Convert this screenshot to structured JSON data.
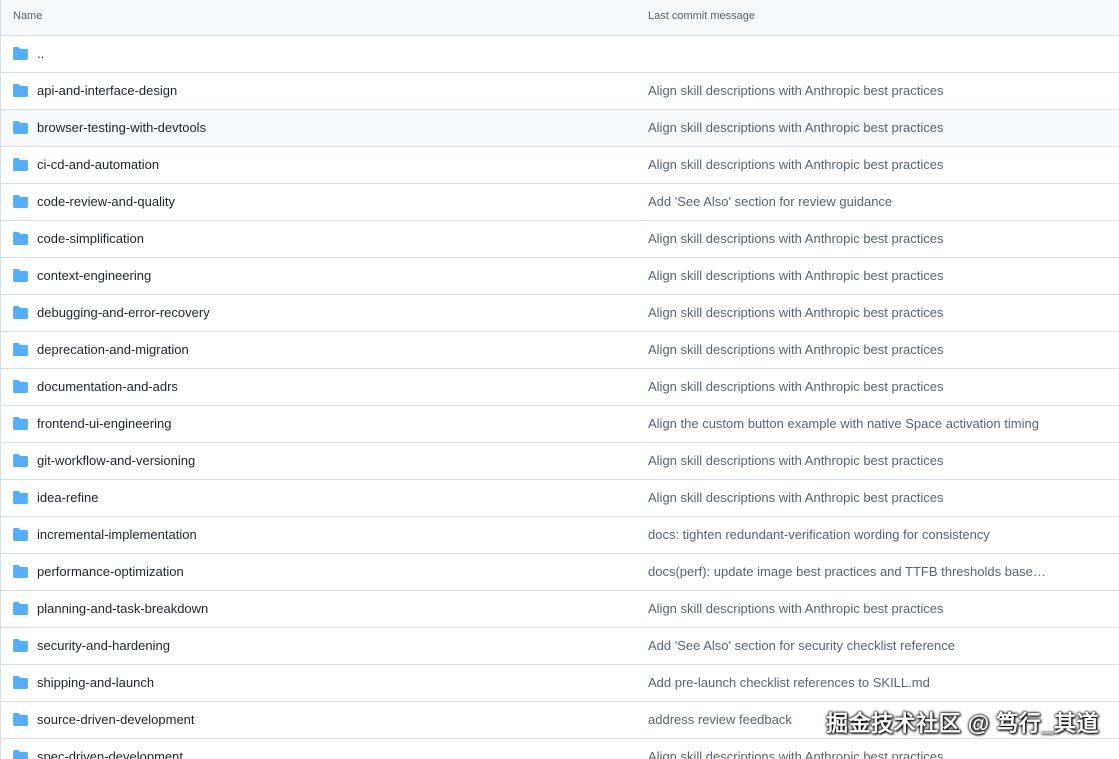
{
  "header": {
    "name_label": "Name",
    "message_label": "Last commit message"
  },
  "folder_color": "#54aeff",
  "rows": [
    {
      "name": "..",
      "message": ""
    },
    {
      "name": "api-and-interface-design",
      "message": "Align skill descriptions with Anthropic best practices"
    },
    {
      "name": "browser-testing-with-devtools",
      "message": "Align skill descriptions with Anthropic best practices"
    },
    {
      "name": "ci-cd-and-automation",
      "message": "Align skill descriptions with Anthropic best practices"
    },
    {
      "name": "code-review-and-quality",
      "message": "Add 'See Also' section for review guidance"
    },
    {
      "name": "code-simplification",
      "message": "Align skill descriptions with Anthropic best practices"
    },
    {
      "name": "context-engineering",
      "message": "Align skill descriptions with Anthropic best practices"
    },
    {
      "name": "debugging-and-error-recovery",
      "message": "Align skill descriptions with Anthropic best practices"
    },
    {
      "name": "deprecation-and-migration",
      "message": "Align skill descriptions with Anthropic best practices"
    },
    {
      "name": "documentation-and-adrs",
      "message": "Align skill descriptions with Anthropic best practices"
    },
    {
      "name": "frontend-ui-engineering",
      "message": "Align the custom button example with native Space activation timing"
    },
    {
      "name": "git-workflow-and-versioning",
      "message": "Align skill descriptions with Anthropic best practices"
    },
    {
      "name": "idea-refine",
      "message": "Align skill descriptions with Anthropic best practices"
    },
    {
      "name": "incremental-implementation",
      "message": "docs: tighten redundant-verification wording for consistency"
    },
    {
      "name": "performance-optimization",
      "message": "docs(perf): update image best practices and TTFB thresholds based on ..."
    },
    {
      "name": "planning-and-task-breakdown",
      "message": "Align skill descriptions with Anthropic best practices"
    },
    {
      "name": "security-and-hardening",
      "message": "Add 'See Also' section for security checklist reference"
    },
    {
      "name": "shipping-and-launch",
      "message": "Add pre-launch checklist references to SKILL.md"
    },
    {
      "name": "source-driven-development",
      "message": "address review feedback"
    },
    {
      "name": "spec-driven-development",
      "message": "Align skill descriptions with Anthropic best practices"
    }
  ],
  "watermark": "掘金技术社区 @ 笃行_其道"
}
